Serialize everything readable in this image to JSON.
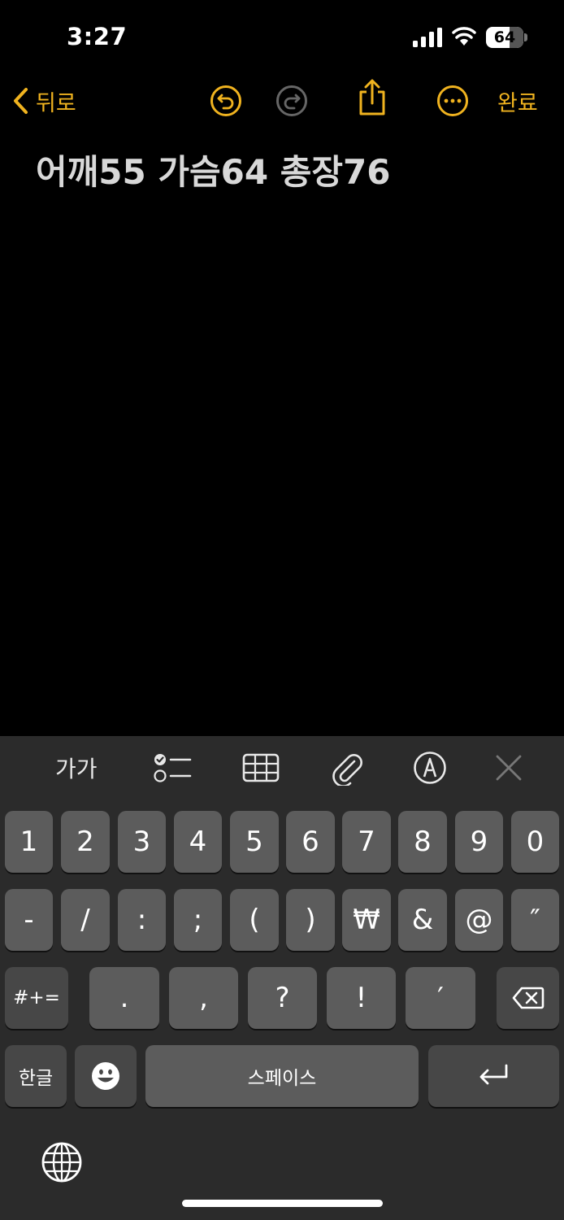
{
  "status_bar": {
    "time": "3:27",
    "battery_level": "64"
  },
  "nav": {
    "back_label": "뒤로",
    "done_label": "완료",
    "accent_color": "#f0b31f",
    "icons": [
      "chevron-left-icon",
      "undo-icon",
      "redo-icon",
      "share-icon",
      "more-icon"
    ]
  },
  "note": {
    "text": "어깨55 가슴64 총장76"
  },
  "toolbar": {
    "format_label": "가가",
    "icons": [
      "checklist-icon",
      "table-icon",
      "paperclip-icon",
      "markup-icon",
      "close-icon"
    ]
  },
  "keyboard": {
    "row1": [
      "1",
      "2",
      "3",
      "4",
      "5",
      "6",
      "7",
      "8",
      "9",
      "0"
    ],
    "row2": [
      "-",
      "/",
      ":",
      ";",
      "(",
      ")",
      "₩",
      "&",
      "@",
      "″"
    ],
    "row3": [
      ".",
      ",",
      "?",
      "!",
      "′"
    ],
    "symbols_label": "#+=",
    "lang_label": "한글",
    "space_label": "스페이스",
    "icons": [
      "delete-icon",
      "emoji-icon",
      "return-icon",
      "globe-icon"
    ]
  }
}
